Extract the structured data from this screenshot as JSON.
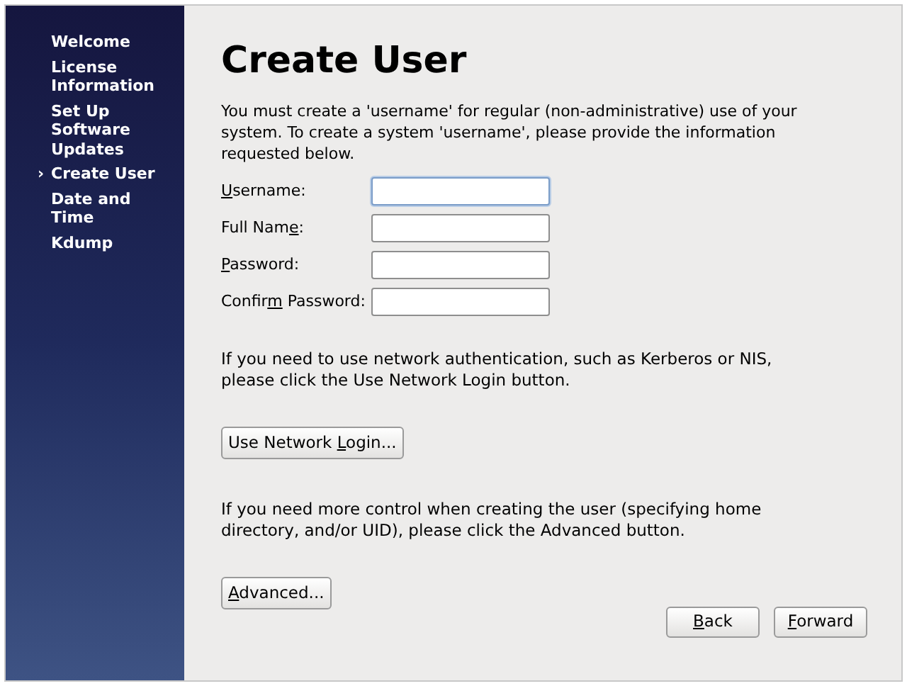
{
  "sidebar": {
    "items": [
      {
        "label": "Welcome",
        "selected": false
      },
      {
        "label": "License Information",
        "selected": false
      },
      {
        "label": "Set Up Software Updates",
        "selected": false
      },
      {
        "label": "Create User",
        "selected": true
      },
      {
        "label": "Date and Time",
        "selected": false
      },
      {
        "label": "Kdump",
        "selected": false
      }
    ],
    "marker": "›"
  },
  "title": "Create User",
  "intro": "You must create a 'username' for regular (non-administrative) use of your system.  To create a system 'username', please provide the information requested below.",
  "fields": [
    {
      "label": {
        "key": "U",
        "rest": "sername:"
      },
      "focused": true
    },
    {
      "label": {
        "lead": "Full Nam",
        "key": "e",
        "rest": ":"
      },
      "focused": false
    },
    {
      "label": {
        "key": "P",
        "rest": "assword:"
      },
      "focused": false
    },
    {
      "label": {
        "lead": "Confir",
        "key": "m",
        "rest": " Password:"
      },
      "focused": false
    }
  ],
  "network_note": "If you need to use network authentication, such as Kerberos or NIS, please click the Use Network Login button.",
  "network_button": {
    "lead": "Use Network ",
    "key": "L",
    "rest": "ogin..."
  },
  "advanced_note": "If you need more control when creating the user (specifying home directory, and/or UID), please click the Advanced button.",
  "advanced_button": {
    "key": "A",
    "rest": "dvanced..."
  },
  "nav_buttons": [
    {
      "key": "B",
      "rest": "ack"
    },
    {
      "key": "F",
      "rest": "orward"
    }
  ]
}
